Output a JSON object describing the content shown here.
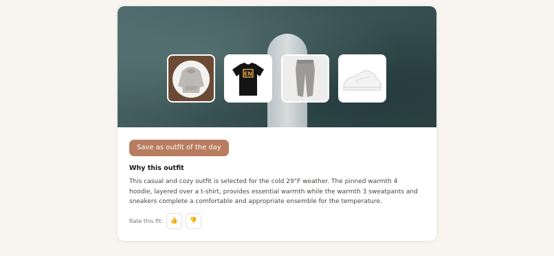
{
  "outfit_items": [
    {
      "name": "hoodie-thumbnail",
      "icon": "hoodie-icon"
    },
    {
      "name": "tshirt-thumbnail",
      "icon": "tshirt-icon"
    },
    {
      "name": "sweatpants-thumbnail",
      "icon": "sweatpants-icon"
    },
    {
      "name": "sneakers-thumbnail",
      "icon": "sneakers-icon"
    }
  ],
  "actions": {
    "save_label": "Save as outfit of the day"
  },
  "explanation": {
    "title": "Why this outfit",
    "text": "This casual and cozy outfit is selected for the cold 29°F weather. The pinned warmth 4 hoodie, layered over a t-shirt, provides essential warmth while the warmth 3 sweatpants and sneakers complete a comfortable and appropriate ensemble for the temperature."
  },
  "rating": {
    "label": "Rate this fit:",
    "thumbs_up": "👍",
    "thumbs_down": "👎"
  },
  "colors": {
    "accent": "#b77d5e",
    "page_bg": "#f8f4f0"
  }
}
